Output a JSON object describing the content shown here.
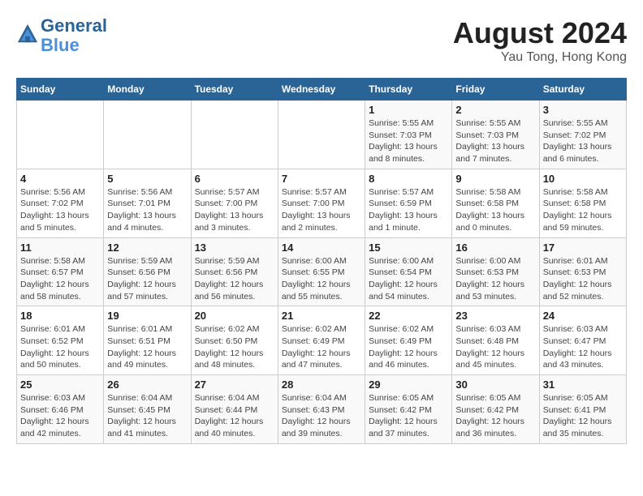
{
  "header": {
    "logo": {
      "line1": "General",
      "line2": "Blue"
    },
    "month": "August 2024",
    "location": "Yau Tong, Hong Kong"
  },
  "weekdays": [
    "Sunday",
    "Monday",
    "Tuesday",
    "Wednesday",
    "Thursday",
    "Friday",
    "Saturday"
  ],
  "weeks": [
    [
      {
        "day": "",
        "info": ""
      },
      {
        "day": "",
        "info": ""
      },
      {
        "day": "",
        "info": ""
      },
      {
        "day": "",
        "info": ""
      },
      {
        "day": "1",
        "sunrise": "5:55 AM",
        "sunset": "7:03 PM",
        "daylight": "13 hours and 8 minutes."
      },
      {
        "day": "2",
        "sunrise": "5:55 AM",
        "sunset": "7:03 PM",
        "daylight": "13 hours and 7 minutes."
      },
      {
        "day": "3",
        "sunrise": "5:55 AM",
        "sunset": "7:02 PM",
        "daylight": "13 hours and 6 minutes."
      }
    ],
    [
      {
        "day": "4",
        "sunrise": "5:56 AM",
        "sunset": "7:02 PM",
        "daylight": "13 hours and 5 minutes."
      },
      {
        "day": "5",
        "sunrise": "5:56 AM",
        "sunset": "7:01 PM",
        "daylight": "13 hours and 4 minutes."
      },
      {
        "day": "6",
        "sunrise": "5:57 AM",
        "sunset": "7:00 PM",
        "daylight": "13 hours and 3 minutes."
      },
      {
        "day": "7",
        "sunrise": "5:57 AM",
        "sunset": "7:00 PM",
        "daylight": "13 hours and 2 minutes."
      },
      {
        "day": "8",
        "sunrise": "5:57 AM",
        "sunset": "6:59 PM",
        "daylight": "13 hours and 1 minute."
      },
      {
        "day": "9",
        "sunrise": "5:58 AM",
        "sunset": "6:58 PM",
        "daylight": "13 hours and 0 minutes."
      },
      {
        "day": "10",
        "sunrise": "5:58 AM",
        "sunset": "6:58 PM",
        "daylight": "12 hours and 59 minutes."
      }
    ],
    [
      {
        "day": "11",
        "sunrise": "5:58 AM",
        "sunset": "6:57 PM",
        "daylight": "12 hours and 58 minutes."
      },
      {
        "day": "12",
        "sunrise": "5:59 AM",
        "sunset": "6:56 PM",
        "daylight": "12 hours and 57 minutes."
      },
      {
        "day": "13",
        "sunrise": "5:59 AM",
        "sunset": "6:56 PM",
        "daylight": "12 hours and 56 minutes."
      },
      {
        "day": "14",
        "sunrise": "6:00 AM",
        "sunset": "6:55 PM",
        "daylight": "12 hours and 55 minutes."
      },
      {
        "day": "15",
        "sunrise": "6:00 AM",
        "sunset": "6:54 PM",
        "daylight": "12 hours and 54 minutes."
      },
      {
        "day": "16",
        "sunrise": "6:00 AM",
        "sunset": "6:53 PM",
        "daylight": "12 hours and 53 minutes."
      },
      {
        "day": "17",
        "sunrise": "6:01 AM",
        "sunset": "6:53 PM",
        "daylight": "12 hours and 52 minutes."
      }
    ],
    [
      {
        "day": "18",
        "sunrise": "6:01 AM",
        "sunset": "6:52 PM",
        "daylight": "12 hours and 50 minutes."
      },
      {
        "day": "19",
        "sunrise": "6:01 AM",
        "sunset": "6:51 PM",
        "daylight": "12 hours and 49 minutes."
      },
      {
        "day": "20",
        "sunrise": "6:02 AM",
        "sunset": "6:50 PM",
        "daylight": "12 hours and 48 minutes."
      },
      {
        "day": "21",
        "sunrise": "6:02 AM",
        "sunset": "6:49 PM",
        "daylight": "12 hours and 47 minutes."
      },
      {
        "day": "22",
        "sunrise": "6:02 AM",
        "sunset": "6:49 PM",
        "daylight": "12 hours and 46 minutes."
      },
      {
        "day": "23",
        "sunrise": "6:03 AM",
        "sunset": "6:48 PM",
        "daylight": "12 hours and 45 minutes."
      },
      {
        "day": "24",
        "sunrise": "6:03 AM",
        "sunset": "6:47 PM",
        "daylight": "12 hours and 43 minutes."
      }
    ],
    [
      {
        "day": "25",
        "sunrise": "6:03 AM",
        "sunset": "6:46 PM",
        "daylight": "12 hours and 42 minutes."
      },
      {
        "day": "26",
        "sunrise": "6:04 AM",
        "sunset": "6:45 PM",
        "daylight": "12 hours and 41 minutes."
      },
      {
        "day": "27",
        "sunrise": "6:04 AM",
        "sunset": "6:44 PM",
        "daylight": "12 hours and 40 minutes."
      },
      {
        "day": "28",
        "sunrise": "6:04 AM",
        "sunset": "6:43 PM",
        "daylight": "12 hours and 39 minutes."
      },
      {
        "day": "29",
        "sunrise": "6:05 AM",
        "sunset": "6:42 PM",
        "daylight": "12 hours and 37 minutes."
      },
      {
        "day": "30",
        "sunrise": "6:05 AM",
        "sunset": "6:42 PM",
        "daylight": "12 hours and 36 minutes."
      },
      {
        "day": "31",
        "sunrise": "6:05 AM",
        "sunset": "6:41 PM",
        "daylight": "12 hours and 35 minutes."
      }
    ]
  ],
  "labels": {
    "sunrise": "Sunrise:",
    "sunset": "Sunset:",
    "daylight": "Daylight:"
  }
}
